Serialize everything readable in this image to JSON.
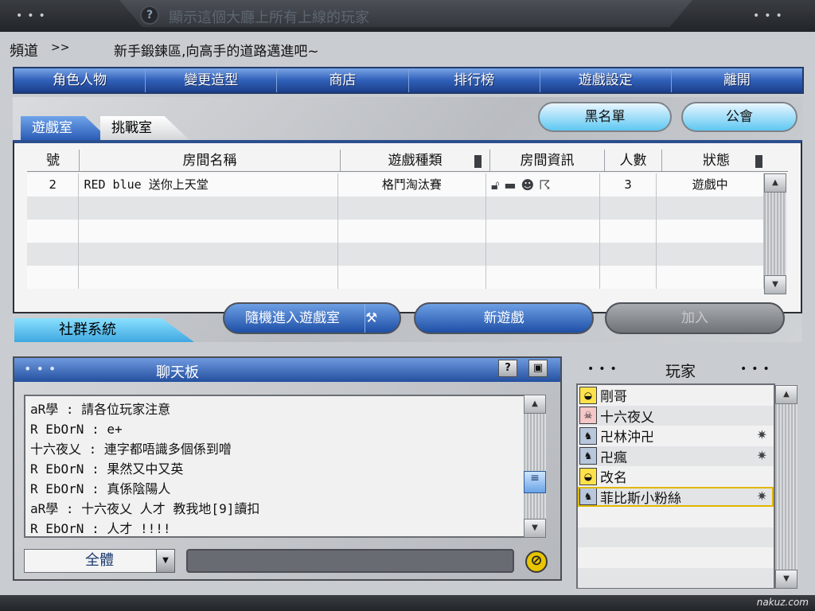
{
  "top": {
    "help_label": "?",
    "title": "顯示這個大廳上所有上線的玩家"
  },
  "channel": {
    "label": "頻道",
    "arrow": ">>",
    "text": "新手鍛鍊區,向高手的道路邁進吧~"
  },
  "menu": [
    "角色人物",
    "變更造型",
    "商店",
    "排行榜",
    "遊戲設定",
    "離開"
  ],
  "tabs": {
    "game_room": "遊戲室",
    "challenge_room": "挑戰室"
  },
  "buttons": {
    "blacklist": "黑名單",
    "guild": "公會",
    "random_join": "隨機進入遊戲室",
    "new_game": "新遊戲",
    "join": "加入",
    "community": "社群系統"
  },
  "room_table": {
    "columns": [
      "號",
      "房間名稱",
      "遊戲種類",
      "房間資訊",
      "人數",
      "狀態"
    ],
    "rows": [
      {
        "num": "2",
        "name": "RED blue 送你上天堂",
        "type": "格鬥淘汰賽",
        "info_icons": [
          "lock-open-icon",
          "gun-icon",
          "smiley-icon",
          "runner-icon"
        ],
        "count": "3",
        "status": "遊戲中"
      },
      {
        "num": "",
        "name": "",
        "type": "",
        "count": "",
        "status": ""
      },
      {
        "num": "",
        "name": "",
        "type": "",
        "count": "",
        "status": ""
      },
      {
        "num": "",
        "name": "",
        "type": "",
        "count": "",
        "status": ""
      },
      {
        "num": "",
        "name": "",
        "type": "",
        "count": "",
        "status": ""
      }
    ]
  },
  "chat": {
    "title": "聊天板",
    "help_label": "?",
    "lines": [
      "aR學 : 請各位玩家注意",
      "R EbOrN : e+",
      "十六夜乂 : 連字都唔識多個係到噌",
      "R EbOrN : 果然又中又英",
      "R EbOrN : 真係陰陽人",
      "aR學 : 十六夜乂 人才  教我地[9]讀扣",
      "R EbOrN : 人才 !!!!"
    ],
    "target": "全體",
    "input_value": ""
  },
  "players": {
    "title": "玩家",
    "list": [
      {
        "name": "剛哥",
        "avatar": "egg-avatar-icon",
        "status": ""
      },
      {
        "name": "十六夜乂",
        "avatar": "ghost-avatar-icon",
        "status": ""
      },
      {
        "name": "卍林沖卍",
        "avatar": "man-avatar-icon",
        "status": "busy-icon"
      },
      {
        "name": "卍瘋",
        "avatar": "man-avatar-icon",
        "status": "busy-icon"
      },
      {
        "name": "改名",
        "avatar": "egg-avatar-icon",
        "status": ""
      },
      {
        "name": "菲比斯小粉絲",
        "avatar": "man-avatar-icon",
        "status": "busy-icon",
        "selected": true
      }
    ]
  },
  "watermark": "nakuz.com",
  "colors": {
    "menu_blue": "#2f5fb8",
    "accent_cyan": "#5ec8f2",
    "dark_frame": "#22252a"
  }
}
